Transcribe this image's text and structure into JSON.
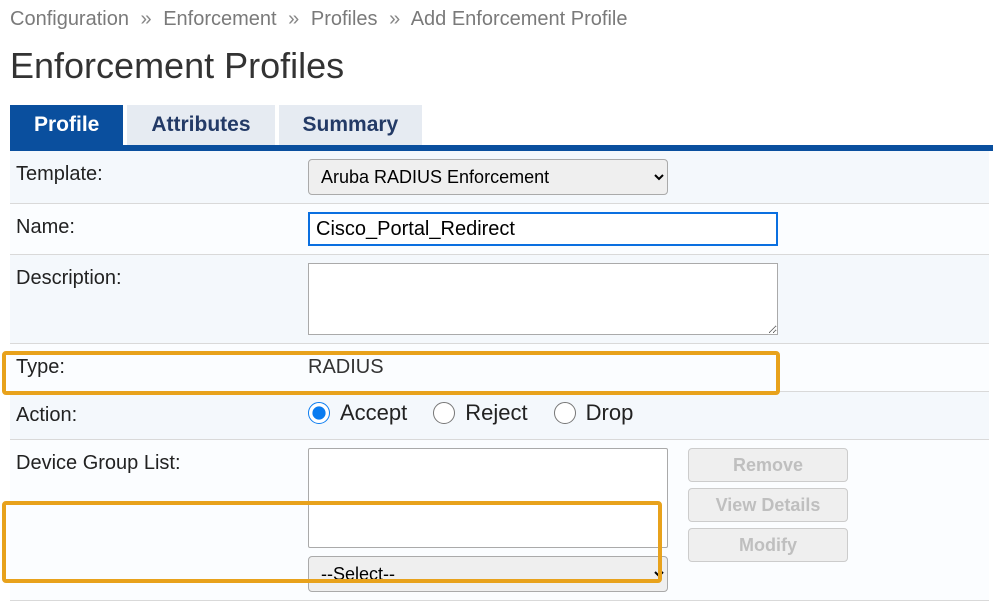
{
  "breadcrumb": {
    "items": [
      "Configuration",
      "Enforcement",
      "Profiles",
      "Add Enforcement Profile"
    ]
  },
  "page_title": "Enforcement Profiles",
  "tabs": [
    {
      "label": "Profile",
      "active": true
    },
    {
      "label": "Attributes",
      "active": false
    },
    {
      "label": "Summary",
      "active": false
    }
  ],
  "form": {
    "template": {
      "label": "Template:",
      "value": "Aruba RADIUS Enforcement"
    },
    "name": {
      "label": "Name:",
      "value": "Cisco_Portal_Redirect"
    },
    "description": {
      "label": "Description:",
      "value": ""
    },
    "type": {
      "label": "Type:",
      "value": "RADIUS"
    },
    "action": {
      "label": "Action:",
      "options": [
        {
          "label": "Accept",
          "selected": true
        },
        {
          "label": "Reject",
          "selected": false
        },
        {
          "label": "Drop",
          "selected": false
        }
      ]
    },
    "device_group_list": {
      "label": "Device Group List:",
      "select_placeholder": "--Select--",
      "buttons": {
        "remove": "Remove",
        "view": "View Details",
        "modify": "Modify"
      }
    }
  }
}
